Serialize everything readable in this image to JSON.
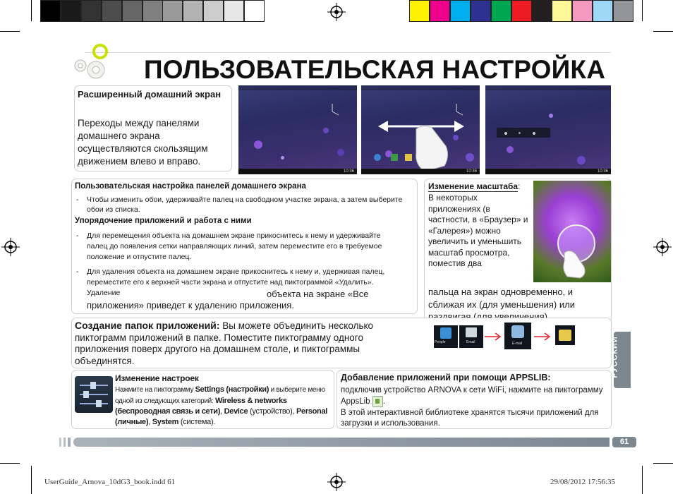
{
  "colors": {
    "gray_swatches": [
      "#000000",
      "#1a1a1a",
      "#333333",
      "#4d4d4d",
      "#666666",
      "#808080",
      "#999999",
      "#b3b3b3",
      "#cccccc",
      "#e6e6e6",
      "#ffffff"
    ],
    "color_swatches": [
      "#fff200",
      "#ec008c",
      "#00aeef",
      "#2e3192",
      "#00a651",
      "#ed1c24",
      "#231f20",
      "#fff799",
      "#f49ac1",
      "#9fd7f7",
      "#939598"
    ],
    "gear_icon": "#f2f2a0",
    "gear_green": "#c8e000",
    "side_tab": "#7d8790"
  },
  "page_title": "ПОЛЬЗОВАТЕЛЬСКАЯ НАСТРОЙКА",
  "home_screen": {
    "heading": "Расширенный домашний экран",
    "body": "Переходы между панелями домашнего экрана осуществляются скользящим движением влево и вправо."
  },
  "screens": {
    "clock": "10:36"
  },
  "customize": {
    "heading": "Пользовательская настройка панелей домашнего экрана",
    "item1": "Чтобы изменить обои, удерживайте палец на свободном участке экрана, а затем выберите обои из списка.",
    "subheading": "Упорядочение приложений и работа с ними",
    "item2": "Для перемещения объекта на домашнем экране прикоснитесь к нему и удерживайте палец до появления сетки направляющих линий, затем переместите его в требуемое положение и отпустите палец.",
    "item3a": "Для удаления объекта на домашнем экране прикоснитесь к нему и, удерживая палец, переместите его к верхней части экрана и отпустите над пиктограммой «Удалить». Удаление",
    "item3b": "объекта на экране «Все приложения» приведет к удалению приложения."
  },
  "zoom": {
    "heading": "Изменение масштаба",
    "colon": ":",
    "body_narrow": "В некоторых приложениях (в частности, в «Браузер» и «Галерея») можно увеличить и уменьшить масштаб просмотра, поместив два",
    "body_wide": "пальца на экран одновременно, и сближая их (для уменьшения) или раздвигая (для увеличения)."
  },
  "folders": {
    "heading": "Создание папок приложений:",
    "body": " Вы можете объединить несколько пиктограмм приложений в папке. Поместите пиктограмму одного приложения поверх другого на домашнем столе, и пиктограммы объединятся.",
    "icon_labels": [
      "People",
      "Email",
      "E-mail"
    ]
  },
  "settings": {
    "heading": "Изменение настроек",
    "text_pre": "Нажмите на пиктограмму ",
    "settings_bold": "Settings (настройки)",
    "text_mid": " и выберите меню одной из следующих категорий: ",
    "wireless_bold": "Wireless & networks (беспроводная связь и сети)",
    "comma1": ", ",
    "device_bold": "Device",
    "device_note": " (устройство), ",
    "personal_bold": "Personal (личные)",
    "comma2": ", ",
    "system_bold": "System",
    "system_note": " (система)."
  },
  "appslib": {
    "heading": "Добавление приложений при помощи APPSLIB:",
    "line1": "подключив устройство ARNOVA к сети WiFi, нажмите на пиктограмму AppsLib",
    "line1_end": ".",
    "line2": "В этой интерактивной библиотеке хранятся тысячи приложений для загрузки и использования."
  },
  "side_tab_label": "РУССКИЙ",
  "page_number": "61",
  "footer": {
    "file": "UserGuide_Arnova_10dG3_book.indd   61",
    "date": "29/08/2012   17:56:35"
  }
}
